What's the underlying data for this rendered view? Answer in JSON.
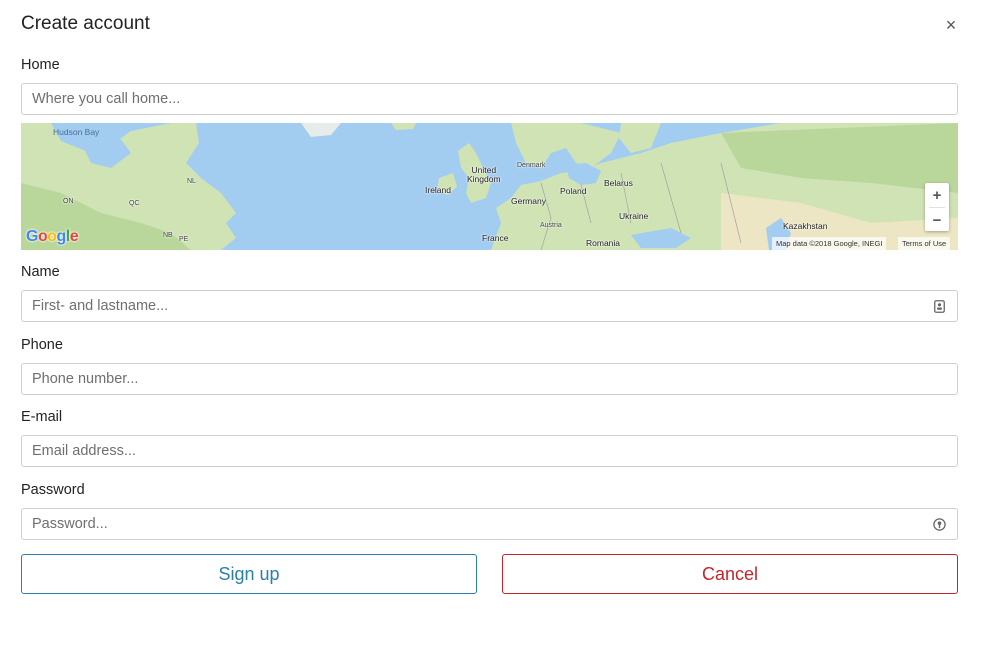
{
  "dialog": {
    "title": "Create account",
    "close_glyph": "×"
  },
  "home": {
    "label": "Home",
    "placeholder": "Where you call home..."
  },
  "map": {
    "place_labels": {
      "hudson_bay": "Hudson Bay",
      "nl": "NL",
      "on": "ON",
      "qc": "QC",
      "nb": "NB",
      "pe": "PE",
      "ireland": "Ireland",
      "united_kingdom": "United\nKingdom",
      "denmark": "Denmark",
      "poland": "Poland",
      "belarus": "Belarus",
      "germany": "Germany",
      "ukraine": "Ukraine",
      "austria": "Austria",
      "france": "France",
      "romania": "Romania",
      "kazakhstan": "Kazakhstan"
    },
    "google_logo": "Google",
    "zoom_in": "+",
    "zoom_out": "−",
    "attribution": "Map data ©2018 Google, INEGI",
    "terms": "Terms of Use",
    "colors": {
      "water": "#a3ccf1",
      "land": "#cfe3b5",
      "land_dark": "#b9d79b",
      "desert": "#ece6c4"
    }
  },
  "name": {
    "label": "Name",
    "placeholder": "First- and lastname...",
    "icon": "contact-card-icon"
  },
  "phone": {
    "label": "Phone",
    "placeholder": "Phone number..."
  },
  "email": {
    "label": "E-mail",
    "placeholder": "Email address..."
  },
  "password": {
    "label": "Password",
    "placeholder": "Password...",
    "icon": "key-icon"
  },
  "actions": {
    "signup_label": "Sign up",
    "cancel_label": "Cancel",
    "signup_color": "#2b7fab",
    "cancel_color": "#c3242b"
  }
}
